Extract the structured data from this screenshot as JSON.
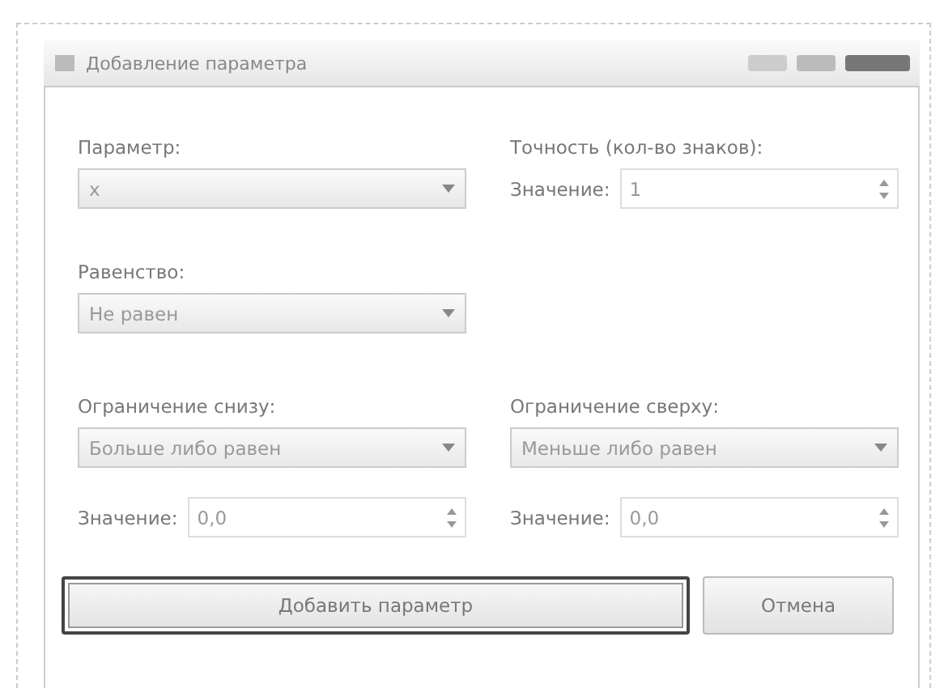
{
  "window": {
    "title": "Добавление параметра"
  },
  "parameter": {
    "label": "Параметр:",
    "value": "x"
  },
  "precision": {
    "label": "Точность (кол-во знаков):",
    "value_label": "Значение:",
    "value": "1"
  },
  "equality": {
    "label": "Равенство:",
    "value": "Не равен"
  },
  "lower_bound": {
    "label": "Ограничение снизу:",
    "value": "Больше либо равен",
    "value_label": "Значение:",
    "number": "0,0"
  },
  "upper_bound": {
    "label": "Ограничение сверху:",
    "value": "Меньше либо равен",
    "value_label": "Значение:",
    "number": "0,0"
  },
  "buttons": [
    {
      "label": "Добавить параметр",
      "focused": true
    },
    {
      "label": "Отмена",
      "focused": false
    }
  ]
}
